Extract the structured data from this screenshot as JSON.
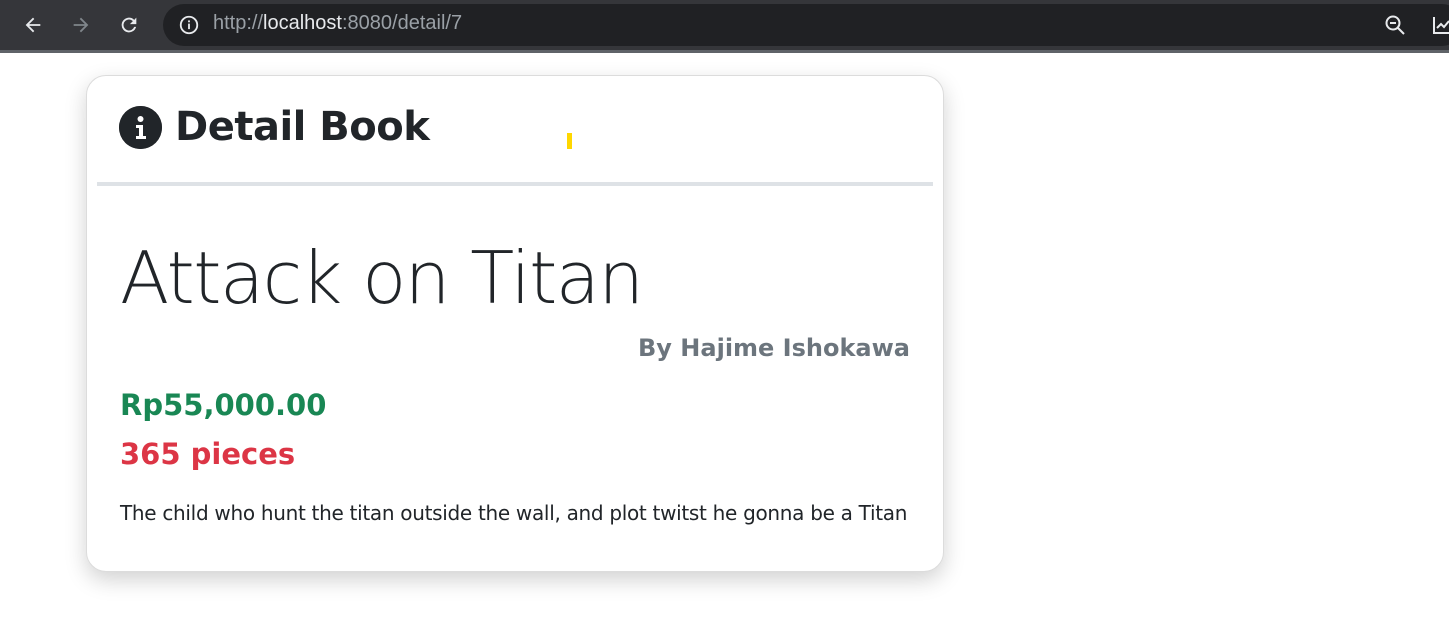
{
  "browser": {
    "url_scheme": "http://",
    "url_host": "localhost",
    "url_path": ":8080/detail/7"
  },
  "card": {
    "header_title": "Detail Book",
    "book": {
      "title": "Attack on Titan",
      "author": "By Hajime Ishokawa",
      "price": "Rp55,000.00",
      "stock": "365 pieces",
      "description": "The child who hunt the titan outside the wall, and plot twitst he gonna be a Titan"
    }
  },
  "colors": {
    "price": "#198754",
    "stock": "#dc3545",
    "author": "#6c757d"
  }
}
